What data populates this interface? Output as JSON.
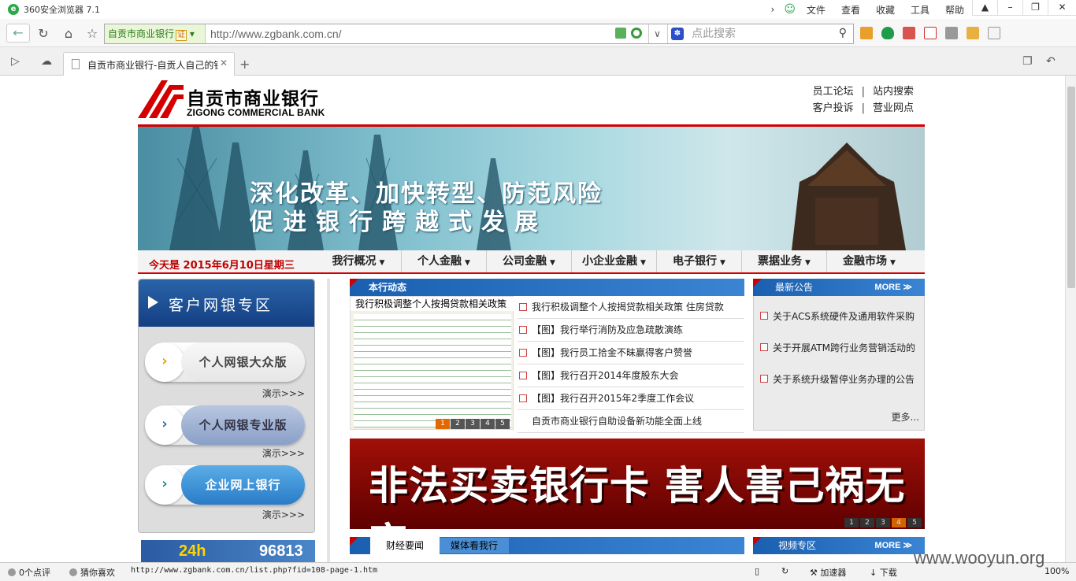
{
  "browser": {
    "title": "360安全浏览器 7.1",
    "menu": [
      "文件",
      "查看",
      "收藏",
      "工具",
      "帮助"
    ],
    "site_name": "自贡市商业银行",
    "cert": "证",
    "url": "http://www.zgbank.com.cn/",
    "search_placeholder": "点此搜索",
    "tab_title": "自贡市商业银行-自贡人自己的银行",
    "status_comments": "0个点评",
    "status_guess": "猜你喜欢",
    "status_url": "http://www.zgbank.com.cn/list.php?fid=108-page-1.htm",
    "status_accel": "加速器",
    "status_download": "下载",
    "zoom": "100%",
    "watermark": "www.wooyun.org"
  },
  "site": {
    "logo_cn": "自贡市商业银行",
    "logo_en": "ZIGONG COMMERCIAL BANK",
    "top_links": [
      "员工论坛",
      "站内搜索",
      "客户投诉",
      "营业网点"
    ],
    "banner_line1": "深化改革、加快转型、防范风险",
    "banner_line2": "促进银行跨越式发展",
    "date": "今天是 2015年6月10日星期三",
    "nav": [
      "我行概况",
      "个人金融",
      "公司金融",
      "小企业金融",
      "电子银行",
      "票据业务",
      "金融市场"
    ],
    "ebank": {
      "title": "客户网银专区",
      "buttons": [
        "个人网银大众版",
        "个人网银专业版",
        "企业网上银行"
      ],
      "demo": "演示>>>"
    },
    "ad24": {
      "left": "24h",
      "right": "96813"
    },
    "news": {
      "title": "本行动态",
      "photo_caption": "我行积极调整个人按揭贷款相关政策",
      "pager": [
        "1",
        "2",
        "3",
        "4",
        "5"
      ],
      "items": [
        "我行积极调整个人按揭贷款相关政策 住房贷款",
        "【图】我行举行消防及应急疏散演练",
        "【图】我行员工拾金不昧赢得客户赞誉",
        "【图】我行召开2014年度股东大会",
        "【图】我行召开2015年2季度工作会议",
        "自贡市商业银行自助设备新功能全面上线"
      ]
    },
    "notice": {
      "title": "最新公告",
      "more": "MORE",
      "items": [
        "关于ACS系统硬件及通用软件采购",
        "关于开展ATM跨行业务营销活动的",
        "关于系统升级暂停业务办理的公告"
      ],
      "more_link": "更多..."
    },
    "red_banner": "非法买卖银行卡 害人害己祸无穷",
    "red_pager": [
      "1",
      "2",
      "3",
      "4",
      "5"
    ],
    "bottom_tabs": [
      "财经要闻",
      "媒体看我行"
    ],
    "video": {
      "title": "视频专区",
      "more": "MORE"
    }
  }
}
